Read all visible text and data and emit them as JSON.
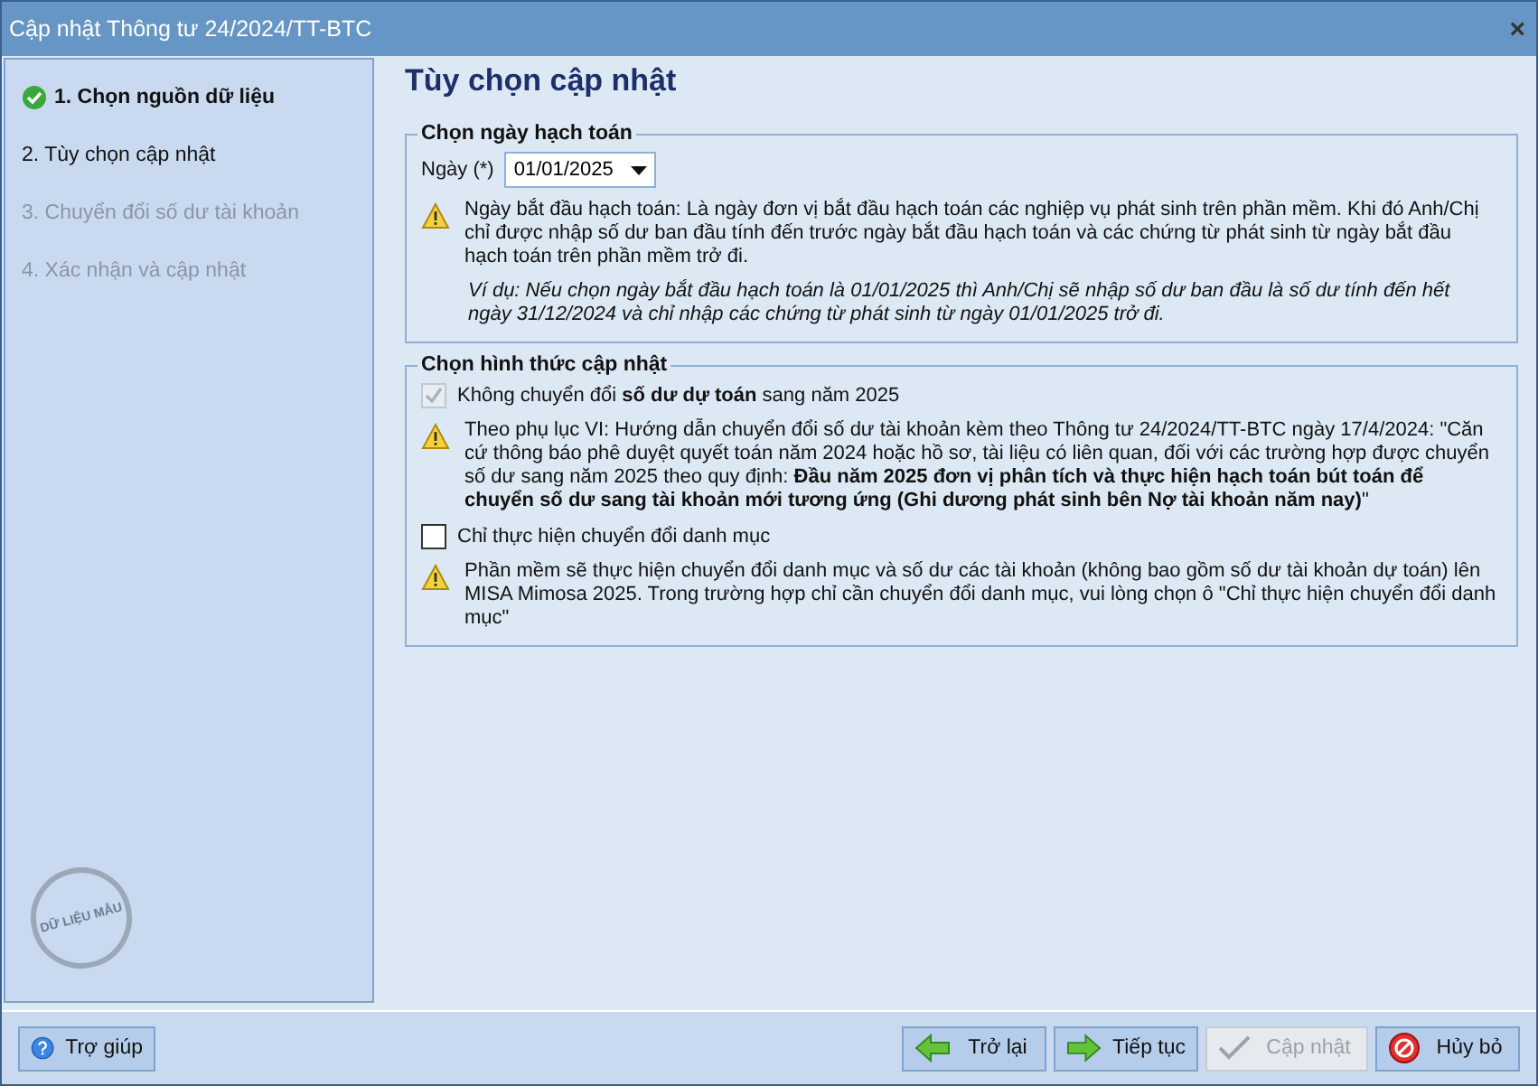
{
  "window": {
    "title": "Cập nhật Thông tư 24/2024/TT-BTC",
    "close": "×"
  },
  "steps": [
    {
      "label": "1. Chọn nguồn dữ liệu",
      "done": true,
      "disabled": false
    },
    {
      "label": "2. Tùy chọn cập nhật",
      "done": false,
      "disabled": false
    },
    {
      "label": "3. Chuyển đổi số dư tài khoản",
      "done": false,
      "disabled": true
    },
    {
      "label": "4. Xác nhận và cập nhật",
      "done": false,
      "disabled": true
    }
  ],
  "stamp": "DỮ LIỆU MẪU",
  "page_title": "Tùy chọn cập nhật",
  "date_group": {
    "legend": "Chọn ngày hạch toán",
    "label": "Ngày (*)",
    "value": "01/01/2025",
    "notes": [
      {
        "kind": "warning",
        "text": "Ngày bắt đầu hạch toán: Là ngày đơn vị bắt đầu hạch toán các nghiệp vụ phát sinh trên phần mềm. Khi đó Anh/Chị chỉ được nhập số dư ban đầu tính đến trước ngày bắt đầu hạch toán và các chứng từ phát sinh từ ngày bắt đầu hạch toán trên phần mềm trở đi."
      },
      {
        "kind": "example",
        "text": "Ví dụ: Nếu chọn ngày bắt đầu hạch toán là 01/01/2025 thì Anh/Chị sẽ nhập số dư ban đầu là số dư tính đến hết ngày 31/12/2024 và chỉ nhập các chứng từ phát sinh từ ngày 01/01/2025 trở đi."
      }
    ]
  },
  "mode_group": {
    "legend": "Chọn hình thức cập nhật",
    "options": [
      {
        "label": "Không chuyển đổi **số dư dự toán** sang năm 2025",
        "checked": true,
        "disabled": true,
        "note": "Theo phụ lục VI: Hướng dẫn chuyển đổi số dư tài khoản kèm theo Thông tư 24/2024/TT-BTC ngày 17/4/2024: \"Căn cứ thông báo phê duyệt quyết toán năm 2024 hoặc hồ sơ, tài liệu có liên quan, đối với các trường hợp được chuyển số dư sang năm 2025 theo quy định: **Đầu năm 2025 đơn vị phân tích và thực hiện hạch toán bút toán để chuyển số dư sang tài khoản mới tương ứng (Ghi dương phát sinh bên Nợ tài khoản năm nay)**\""
      },
      {
        "label": "Chỉ thực hiện chuyển đổi danh mục",
        "checked": false,
        "disabled": false,
        "note": "Phần mềm sẽ thực hiện chuyển đổi danh mục và số dư các tài khoản (không bao gồm số dư tài khoản dự toán) lên MISA Mimosa 2025. Trong trường hợp chỉ cần chuyển đổi danh mục, vui lòng chọn ô \"Chỉ thực hiện chuyển đổi danh mục\""
      }
    ]
  },
  "help_button": {
    "label": "Trợ giúp",
    "kind": "help"
  },
  "buttons": [
    {
      "label": "Trở lại",
      "kind": "back",
      "disabled": false
    },
    {
      "label": "Tiếp tục",
      "kind": "next",
      "disabled": false
    },
    {
      "label": "Cập nhật",
      "kind": "check",
      "disabled": true
    },
    {
      "label": "Hủy bỏ",
      "kind": "cancel",
      "disabled": false
    }
  ]
}
